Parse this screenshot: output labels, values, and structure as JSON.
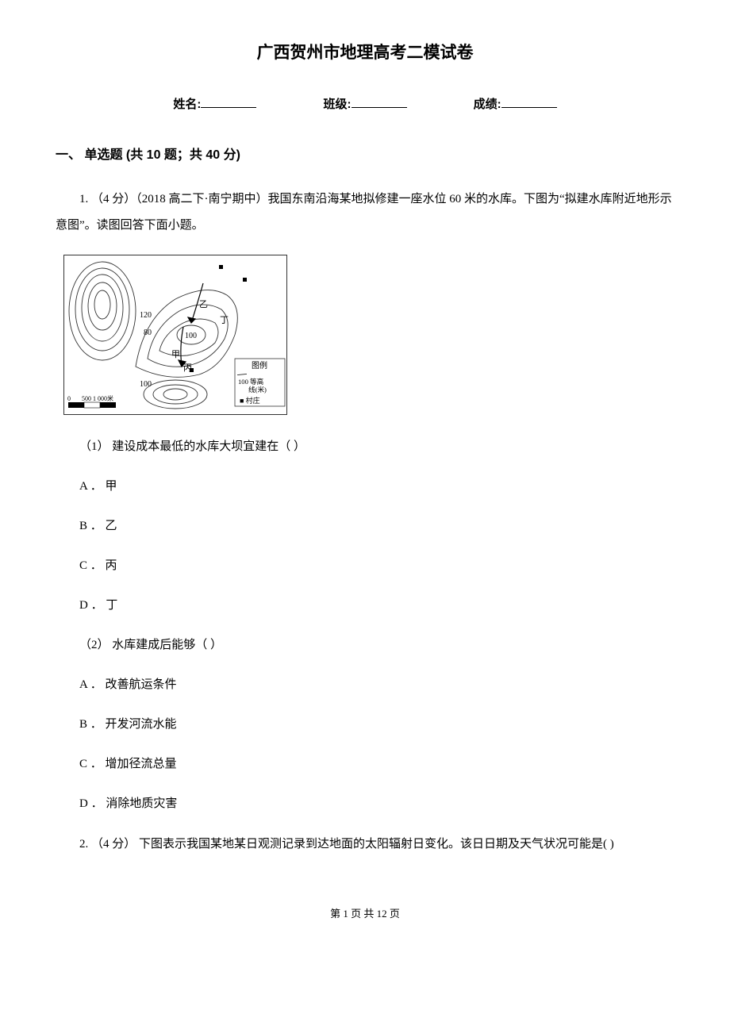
{
  "title": "广西贺州市地理高考二模试卷",
  "info": {
    "name_label": "姓名:",
    "class_label": "班级:",
    "score_label": "成绩:"
  },
  "section1": {
    "heading": "一、 单选题 (共 10 题；共 40 分)"
  },
  "q1": {
    "stem": "1. （4 分）（2018 高二下·南宁期中）我国东南沿海某地拟修建一座水位 60 米的水库。下图为“拟建水库附近地形示意图”。读图回答下面小题。",
    "sub1": "（1）  建设成本最低的水库大坝宜建在（       ）",
    "optA": "A ．  甲",
    "optB": "B ．  乙",
    "optC": "C ．  丙",
    "optD": "D ．  丁",
    "sub2": "（2）  水库建成后能够（       ）",
    "opt2A": "A ．  改善航运条件",
    "opt2B": "B ．  开发河流水能",
    "opt2C": "C ．  增加径流总量",
    "opt2D": "D ．  消除地质灾害"
  },
  "q2": {
    "stem": "2. （4 分）  下图表示我国某地某日观测记录到达地面的太阳辐射日变化。该日日期及天气状况可能是(        )"
  },
  "map": {
    "legend_title": "图例",
    "legend_contour": "100 等高线(米)",
    "legend_village": "■ 村庄",
    "scale": "0",
    "scale2": "500 1 000米",
    "labels": {
      "c120": "120",
      "c80": "80",
      "c100a": "100",
      "c100b": "100",
      "jia": "甲",
      "yi": "乙",
      "bing": "丙",
      "ding": "丁"
    }
  },
  "footer": "第  1  页  共  12  页"
}
